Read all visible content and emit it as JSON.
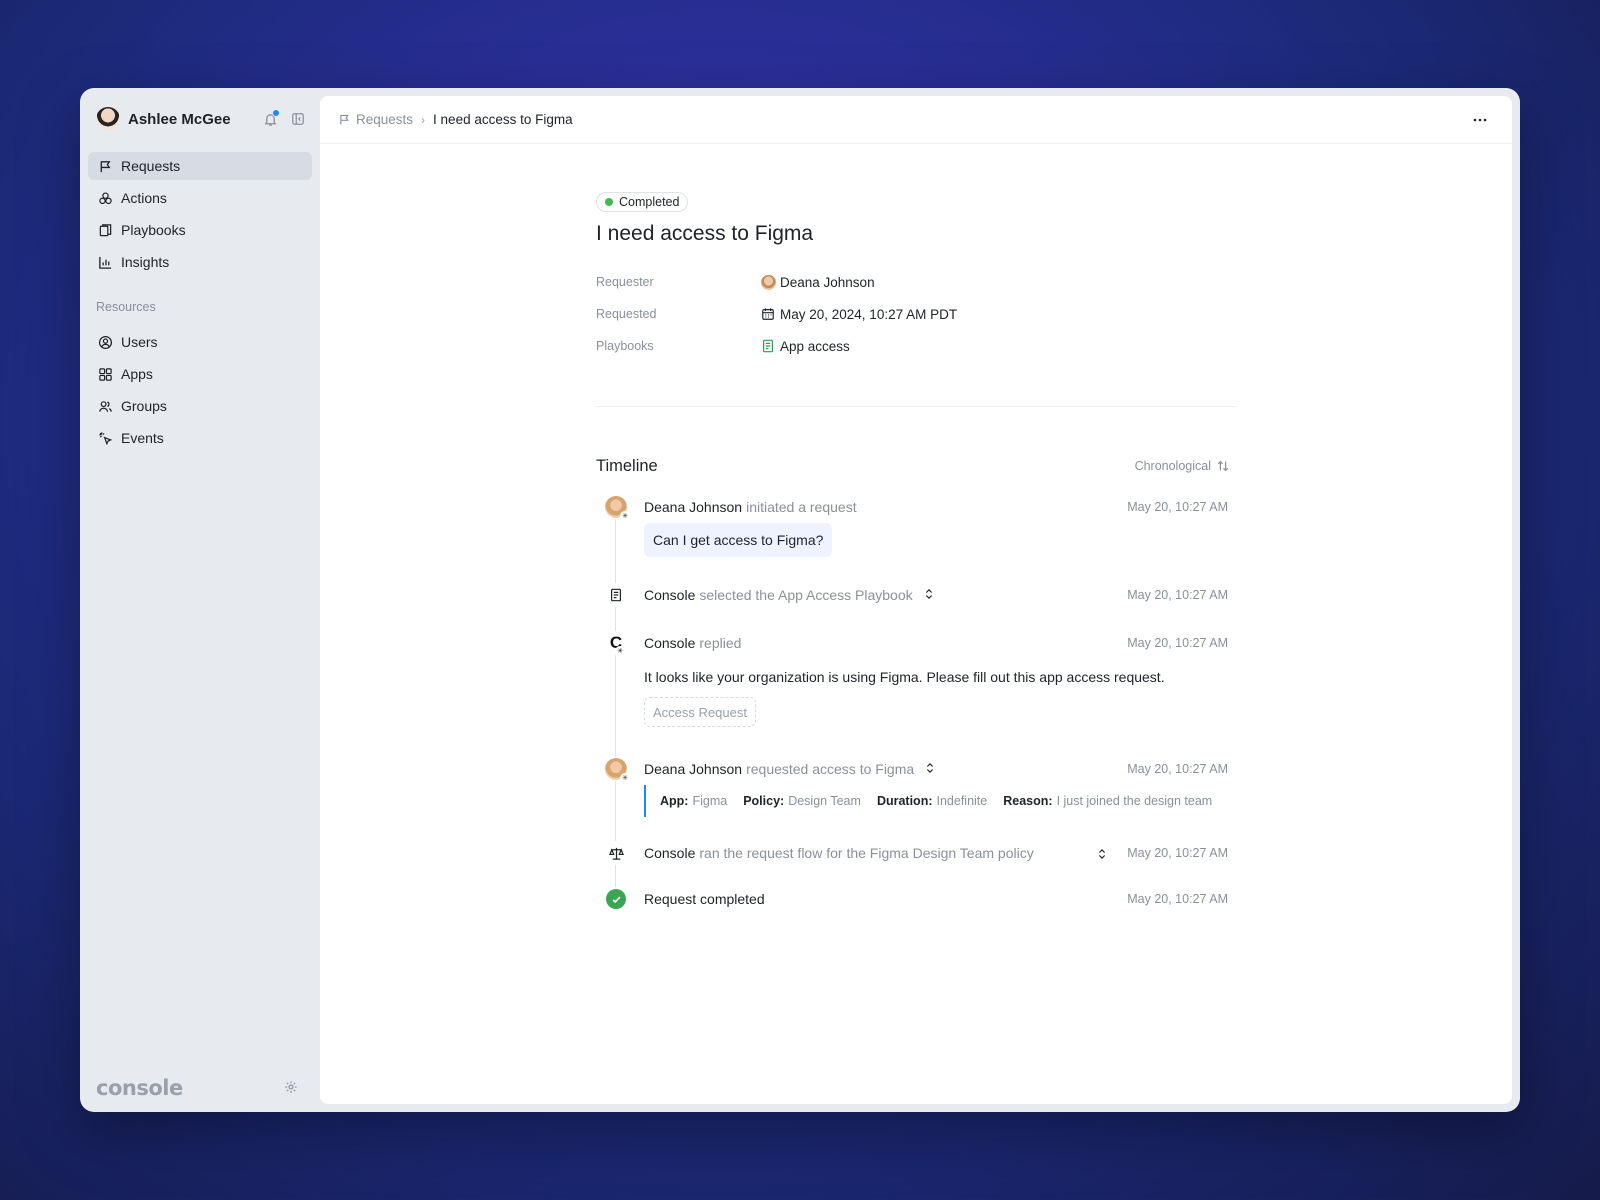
{
  "user": {
    "name": "Ashlee McGee"
  },
  "sidebar": {
    "items": [
      {
        "label": "Requests",
        "icon": "flag-icon"
      },
      {
        "label": "Actions",
        "icon": "actions-icon"
      },
      {
        "label": "Playbooks",
        "icon": "playbooks-icon"
      },
      {
        "label": "Insights",
        "icon": "chart-icon"
      }
    ],
    "resources_label": "Resources",
    "resources": [
      {
        "label": "Users",
        "icon": "user-circle-icon"
      },
      {
        "label": "Apps",
        "icon": "grid-icon"
      },
      {
        "label": "Groups",
        "icon": "group-icon"
      },
      {
        "label": "Events",
        "icon": "pointer-icon"
      }
    ],
    "brand": "console"
  },
  "breadcrumb": {
    "parent": "Requests",
    "current": "I need access to Figma"
  },
  "request": {
    "status": "Completed",
    "status_color": "#3fb950",
    "title": "I need access to Figma",
    "requester_label": "Requester",
    "requester": "Deana Johnson",
    "requested_label": "Requested",
    "requested": "May 20, 2024, 10:27 AM PDT",
    "playbooks_label": "Playbooks",
    "playbook": "App access"
  },
  "timeline": {
    "title": "Timeline",
    "sort_label": "Chronological",
    "events": [
      {
        "actor": "Deana Johnson",
        "action": "initiated a request",
        "time": "May 20, 10:27 AM",
        "message": "Can I get access to Figma?"
      },
      {
        "actor": "Console",
        "action": "selected the App Access Playbook",
        "time": "May 20, 10:27 AM"
      },
      {
        "actor": "Console",
        "action": "replied",
        "time": "May 20, 10:27 AM",
        "message": "It looks like your organization is using Figma. Please fill out this app access request.",
        "button": "Access Request"
      },
      {
        "actor": "Deana Johnson",
        "action": "requested access to Figma",
        "time": "May 20, 10:27 AM",
        "fields": [
          {
            "label": "App:",
            "value": "Figma"
          },
          {
            "label": "Policy:",
            "value": "Design Team"
          },
          {
            "label": "Duration:",
            "value": "Indefinite"
          },
          {
            "label": "Reason:",
            "value": "I just joined the design team"
          }
        ]
      },
      {
        "actor": "Console",
        "action": "ran the request flow for the Figma Design Team policy",
        "time": "May 20, 10:27 AM"
      },
      {
        "actor": "Request completed",
        "action": "",
        "time": "May 20, 10:27 AM"
      }
    ]
  },
  "colors": {
    "accent": "#1e88ff",
    "success": "#3aa655"
  }
}
